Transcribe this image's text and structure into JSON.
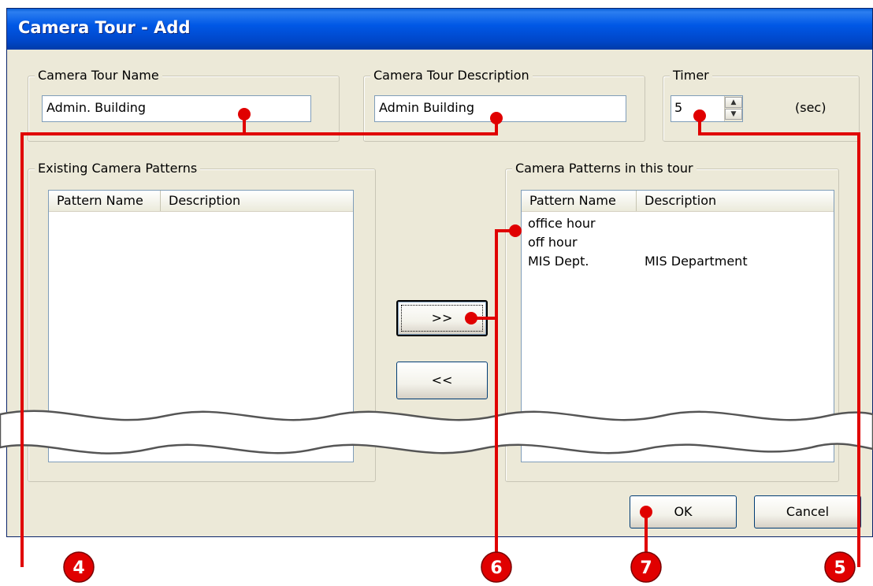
{
  "window": {
    "title": "Camera Tour - Add"
  },
  "tour_name": {
    "label": "Camera Tour Name",
    "value": "Admin. Building"
  },
  "tour_description": {
    "label": "Camera Tour Description",
    "value": "Admin Building"
  },
  "timer": {
    "label": "Timer",
    "value": "5",
    "unit": "(sec)"
  },
  "existing_patterns": {
    "label": "Existing Camera Patterns",
    "columns": [
      "Pattern Name",
      "Description"
    ],
    "rows": []
  },
  "tour_patterns": {
    "label": "Camera Patterns in this tour",
    "columns": [
      "Pattern Name",
      "Description"
    ],
    "rows": [
      {
        "name": "office hour",
        "description": ""
      },
      {
        "name": "off hour",
        "description": ""
      },
      {
        "name": "MIS Dept.",
        "description": "MIS Department"
      }
    ]
  },
  "buttons": {
    "add": ">>",
    "remove": "<<",
    "ok": "OK",
    "cancel": "Cancel"
  },
  "callouts": [
    "4",
    "6",
    "7",
    "5"
  ],
  "colors": {
    "callout_red": "#e00000",
    "title_blue": "#0054e3",
    "dialog_bg": "#ece9d8"
  }
}
